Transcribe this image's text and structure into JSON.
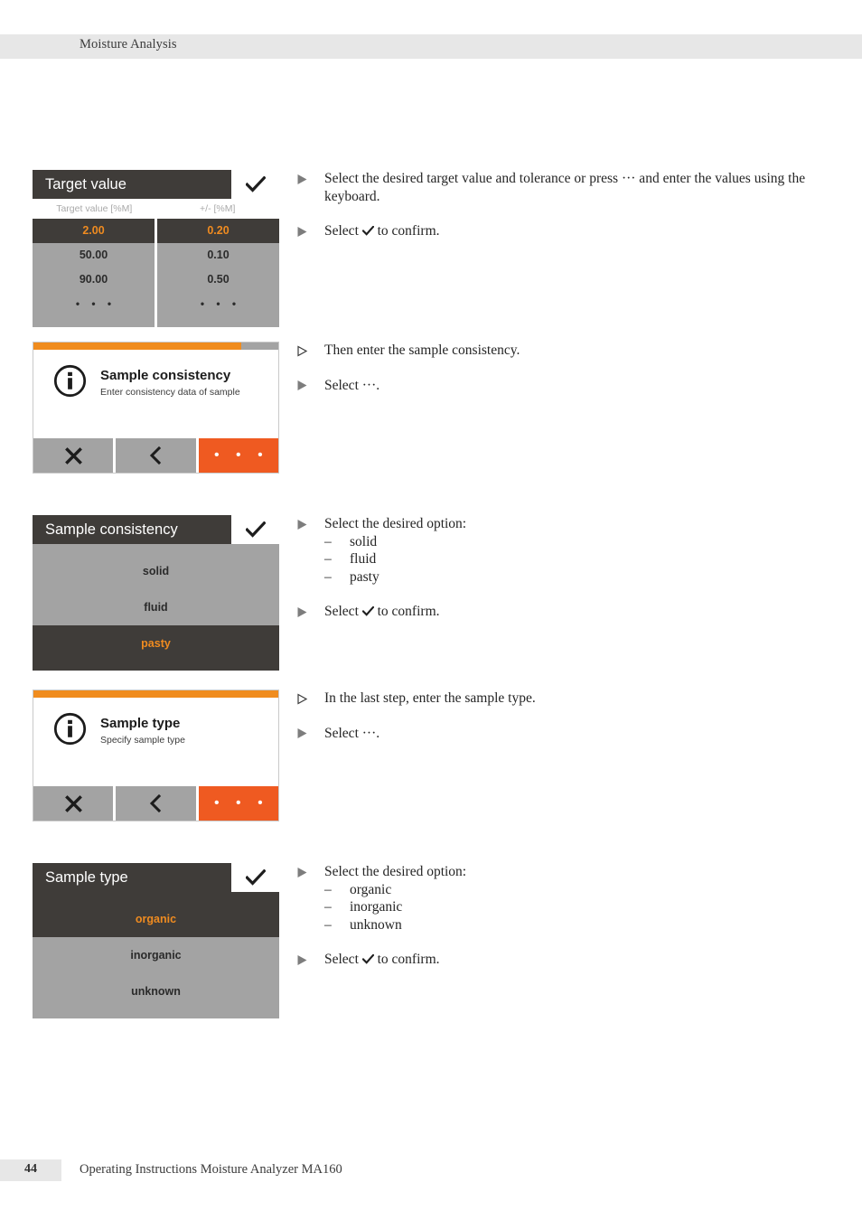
{
  "header": {
    "title": "Moisture Analysis"
  },
  "footer": {
    "page_number": "44",
    "text": "Operating Instructions Moisture Analyzer MA160"
  },
  "colors": {
    "accent_orange": "#ef8b20",
    "button_orange": "#ef5a21",
    "dark_gray": "#3f3c39",
    "mid_gray": "#a3a3a3",
    "header_band": "#e7e7e7"
  },
  "steps": [
    {
      "id": "target-value",
      "device": {
        "type": "list",
        "title": "Target value",
        "confirm_icon": "check-icon",
        "columns": [
          {
            "header": "Target value [%M]",
            "cells": [
              {
                "value": "2.00",
                "selected": true
              },
              {
                "value": "50.00",
                "selected": false
              },
              {
                "value": "90.00",
                "selected": false
              },
              {
                "value": "• • •",
                "selected": false
              }
            ]
          },
          {
            "header": "+/- [%M]",
            "cells": [
              {
                "value": "0.20",
                "selected": true
              },
              {
                "value": "0.10",
                "selected": false
              },
              {
                "value": "0.50",
                "selected": false
              },
              {
                "value": "• • •",
                "selected": false
              }
            ]
          }
        ]
      },
      "instructions": [
        {
          "marker": "filled-triangle",
          "text": "Select the desired target value and tolerance or press ··· and enter the values using the keyboard."
        },
        {
          "marker": "filled-triangle",
          "text_before_check": "Select ",
          "check": "check-icon",
          "text_after_check": " to confirm."
        }
      ]
    },
    {
      "id": "sample-consistency-info",
      "device": {
        "type": "info",
        "progress_percent": 85,
        "icon": "info-icon",
        "title": "Sample consistency",
        "subtitle": "Enter consistency data of sample",
        "buttons": [
          {
            "name": "cancel-button",
            "icon": "close-x-icon",
            "accent": false
          },
          {
            "name": "back-button",
            "icon": "chevron-left-icon",
            "accent": false
          },
          {
            "name": "more-button",
            "icon": "ellipsis-icon",
            "label": "• • •",
            "accent": true
          }
        ]
      },
      "instructions": [
        {
          "marker": "hollow-triangle",
          "text": "Then enter the sample consistency."
        },
        {
          "marker": "filled-triangle",
          "text": "Select ···."
        }
      ]
    },
    {
      "id": "sample-consistency-list",
      "device": {
        "type": "list",
        "title": "Sample consistency",
        "confirm_icon": "check-icon",
        "options": [
          {
            "label": "solid",
            "selected": false
          },
          {
            "label": "fluid",
            "selected": false
          },
          {
            "label": "pasty",
            "selected": true
          }
        ]
      },
      "instructions": [
        {
          "marker": "filled-triangle",
          "text": "Select the desired option:",
          "sub_items": [
            "solid",
            "fluid",
            "pasty"
          ]
        },
        {
          "marker": "filled-triangle",
          "text_before_check": "Select ",
          "check": "check-icon",
          "text_after_check": " to confirm."
        }
      ]
    },
    {
      "id": "sample-type-info",
      "device": {
        "type": "info",
        "progress_percent": 100,
        "icon": "info-icon",
        "title": "Sample type",
        "subtitle": "Specify sample type",
        "buttons": [
          {
            "name": "cancel-button",
            "icon": "close-x-icon",
            "accent": false
          },
          {
            "name": "back-button",
            "icon": "chevron-left-icon",
            "accent": false
          },
          {
            "name": "more-button",
            "icon": "ellipsis-icon",
            "label": "• • •",
            "accent": true
          }
        ]
      },
      "instructions": [
        {
          "marker": "hollow-triangle",
          "text": "In the last step, enter the sample type."
        },
        {
          "marker": "filled-triangle",
          "text": "Select ···."
        }
      ]
    },
    {
      "id": "sample-type-list",
      "device": {
        "type": "list",
        "title": "Sample type",
        "confirm_icon": "check-icon",
        "options": [
          {
            "label": "organic",
            "selected": true
          },
          {
            "label": "inorganic",
            "selected": false
          },
          {
            "label": "unknown",
            "selected": false
          }
        ]
      },
      "instructions": [
        {
          "marker": "filled-triangle",
          "text": "Select the desired option:",
          "sub_items": [
            "organic",
            "inorganic",
            "unknown"
          ]
        },
        {
          "marker": "filled-triangle",
          "text_before_check": "Select ",
          "check": "check-icon",
          "text_after_check": " to confirm."
        }
      ]
    }
  ]
}
